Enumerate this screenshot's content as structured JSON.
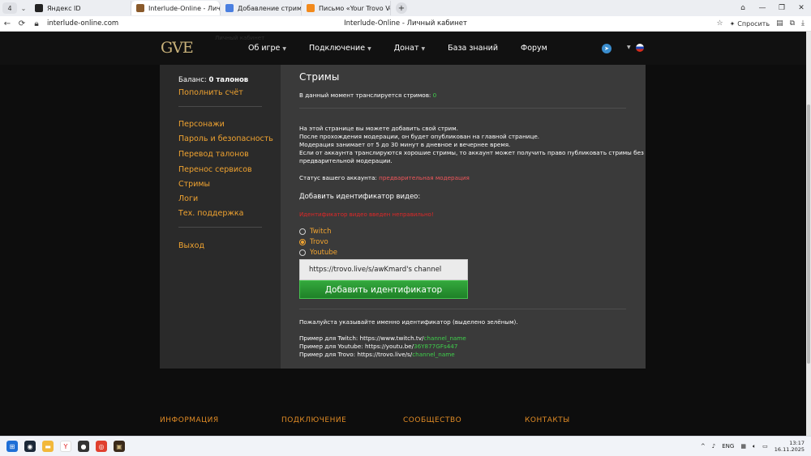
{
  "browser": {
    "tab_count": "4",
    "tabs": [
      {
        "label": "Яндекс ID",
        "favicon_color": "#222222"
      },
      {
        "label": "Interlude-Online - Личн",
        "favicon_color": "#8a5a2b",
        "active": true
      },
      {
        "label": "Добавление стримов на",
        "favicon_color": "#4a7fe0"
      },
      {
        "label": "Письмо «Your Trovo Verifi",
        "favicon_color": "#f28a1c"
      }
    ],
    "url": "interlude-online.com",
    "page_title": "Interlude-Online - Личный кабинет",
    "ask_label": "Спросить"
  },
  "header": {
    "logo": "GVE",
    "ghost_crumb": "Личный кабинет",
    "nav": [
      {
        "label": "Об игре",
        "has_dropdown": true
      },
      {
        "label": "Подключение",
        "has_dropdown": true
      },
      {
        "label": "Донат",
        "has_dropdown": true
      },
      {
        "label": "База знаний",
        "has_dropdown": false
      },
      {
        "label": "Форум",
        "has_dropdown": false
      }
    ]
  },
  "sidebar": {
    "balance_label": "Баланс:",
    "balance_value": "0 талонов",
    "topup": "Пополнить счёт",
    "menu": [
      "Персонажи",
      "Пароль и безопасность",
      "Перевод талонов",
      "Перенос сервисов",
      "Стримы",
      "Логи",
      "Тех. поддержка"
    ],
    "logout": "Выход"
  },
  "streams": {
    "title": "Стримы",
    "live_prefix": "В данный момент транслируется стримов:",
    "live_count": "0",
    "info_lines": [
      "На этой странице вы можете добавить свой стрим.",
      "После прохождения модерации, он будет опубликован на главной странице.",
      "Модерация занимает от 5 до 30 минут в дневное и вечернее время.",
      "Если от аккаунта транслируются хорошие стримы, то аккаунт может получить право публиковать стримы без",
      "предварительной модерации."
    ],
    "status_prefix": "Статус вашего аккаунта:",
    "status_value": "предварительная модерация",
    "add_title": "Добавить идентификатор видео:",
    "error": "Идентификатор видео введен неправильно!",
    "platforms": [
      {
        "label": "Twitch",
        "checked": false
      },
      {
        "label": "Trovo",
        "checked": true
      },
      {
        "label": "Youtube",
        "checked": false
      }
    ],
    "input_value": "https://trovo.live/s/awKmard's channel",
    "add_button": "Добавить идентификатор",
    "hint": "Пожалуйста указывайте именно идентификатор (выделено зелёным).",
    "examples": [
      {
        "prefix": "Пример для Twitch: https://www.twitch.tv/",
        "id": "channel_name"
      },
      {
        "prefix": "Пример для Youtube: https://youtu.be/",
        "id": "36Y877GFs447"
      },
      {
        "prefix": "Пример для Trovo: https://trovo.live/s/",
        "id": "channel_name"
      }
    ]
  },
  "footer": {
    "headings": [
      "ИНФОРМАЦИЯ",
      "ПОДКЛЮЧЕНИЕ",
      "СООБЩЕСТВО",
      "КОНТАКТЫ"
    ]
  },
  "taskbar": {
    "lang": "ENG",
    "time": "13:17",
    "date": "16.11.2025"
  }
}
